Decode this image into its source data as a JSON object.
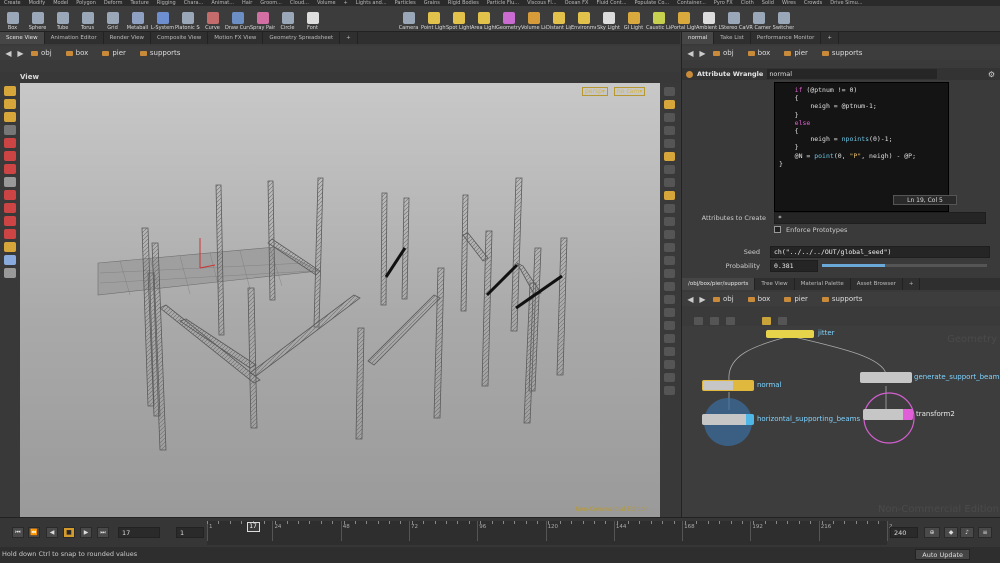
{
  "menubar": [
    "Create",
    "Modify",
    "Model",
    "Polygon",
    "Deform",
    "Texture",
    "Rigging",
    "Chara...",
    "Animat...",
    "Hair",
    "Groom...",
    "Cloud...",
    "Volume",
    "+",
    "Lights and...",
    "Particles",
    "Grains",
    "Rigid Bodies",
    "Particle Flu...",
    "Viscous Fl...",
    "Ocean FX",
    "Fluid Cont...",
    "Populate Co...",
    "Container...",
    "Pyro FX",
    "Cloth",
    "Solid",
    "Wires",
    "Crowds",
    "Drive Simu..."
  ],
  "shelf_left": [
    {
      "label": "Box",
      "color": "#9aa7b8"
    },
    {
      "label": "Sphere",
      "color": "#9aa7b8"
    },
    {
      "label": "Tube",
      "color": "#9aa7b8"
    },
    {
      "label": "Torus",
      "color": "#9aa7b8"
    },
    {
      "label": "Grid",
      "color": "#9aa7b8"
    },
    {
      "label": "Metaball",
      "color": "#8fa1c2"
    },
    {
      "label": "L-System",
      "color": "#6d8fd2"
    },
    {
      "label": "Platonic Sol...",
      "color": "#9aa7b8"
    },
    {
      "label": "Curve",
      "color": "#c46b6b"
    },
    {
      "label": "Draw Curve",
      "color": "#6b8fc4"
    },
    {
      "label": "Spray Paint",
      "color": "#d46fa3"
    },
    {
      "label": "Circle",
      "color": "#9aa7b8"
    },
    {
      "label": "Font",
      "color": "#dddddd"
    }
  ],
  "shelf_right": [
    {
      "label": "Camera",
      "color": "#9aa7b8"
    },
    {
      "label": "Point Light",
      "color": "#e2c24b"
    },
    {
      "label": "Spot Light",
      "color": "#e2c24b"
    },
    {
      "label": "Area Light",
      "color": "#e2c24b"
    },
    {
      "label": "Geometry L...",
      "color": "#c96bd0"
    },
    {
      "label": "Volume Light",
      "color": "#d89b3a"
    },
    {
      "label": "Distant Light",
      "color": "#e2c24b"
    },
    {
      "label": "Environmen...",
      "color": "#e2c24b"
    },
    {
      "label": "Sky Light",
      "color": "#dcdcdc"
    },
    {
      "label": "GI Light",
      "color": "#d9a93d"
    },
    {
      "label": "Caustic Light",
      "color": "#c8d04f"
    },
    {
      "label": "Portal Light",
      "color": "#d9a93d"
    },
    {
      "label": "Ambient Lig...",
      "color": "#dcdcdc"
    },
    {
      "label": "Stereo Cam...",
      "color": "#9aa7b8"
    },
    {
      "label": "VR Camera",
      "color": "#9aa7b8"
    },
    {
      "label": "Switcher",
      "color": "#9aa7b8"
    }
  ],
  "left_tabs": [
    "Scene View",
    "Animation Editor",
    "Render View",
    "Composite View",
    "Motion FX View",
    "Geometry Spreadsheet",
    "+"
  ],
  "path": {
    "root": "obj",
    "items": [
      "box",
      "pier",
      "supports"
    ]
  },
  "view": {
    "title": "View",
    "persp": "persp▾",
    "cam": "no cam▾",
    "watermark": "Non-Commercial Edition"
  },
  "right_top": {
    "tabs": [
      "normal",
      "Take List",
      "Performance Monitor",
      "+"
    ],
    "wrangle_title": "Attribute Wrangle",
    "wrangle_name": "normal",
    "code_lines": [
      {
        "indent": "    ",
        "parts": [
          [
            "kw",
            "if"
          ],
          [
            "",
            " (@ptnum != 0)"
          ]
        ]
      },
      {
        "indent": "    ",
        "parts": [
          [
            "",
            "{"
          ]
        ]
      },
      {
        "indent": "        ",
        "parts": [
          [
            "",
            "neigh = @ptnum-1;"
          ]
        ]
      },
      {
        "indent": "    ",
        "parts": [
          [
            "",
            "}"
          ]
        ]
      },
      {
        "indent": "    ",
        "parts": [
          [
            "kw",
            "else"
          ]
        ]
      },
      {
        "indent": "    ",
        "parts": [
          [
            "",
            "{"
          ]
        ]
      },
      {
        "indent": "        ",
        "parts": [
          [
            "",
            "neigh = "
          ],
          [
            "fn",
            "npoints"
          ],
          [
            "",
            "(0)-1;"
          ]
        ]
      },
      {
        "indent": "    ",
        "parts": [
          [
            "",
            "}"
          ]
        ]
      },
      {
        "indent": "",
        "parts": [
          [
            "",
            ""
          ]
        ]
      },
      {
        "indent": "    ",
        "parts": [
          [
            "",
            "@N = "
          ],
          [
            "fn",
            "point"
          ],
          [
            "",
            "(0, "
          ],
          [
            "st",
            "\"P\""
          ],
          [
            "",
            ", neigh) - @P;"
          ]
        ]
      },
      {
        "indent": "",
        "parts": [
          [
            "",
            "}"
          ]
        ]
      }
    ],
    "cursor": "Ln 19, Col 5",
    "attrs_label": "Attributes to Create",
    "attrs_value": "*",
    "enforce_label": "Enforce Prototypes",
    "seed_label": "Seed",
    "seed_value": "ch(\"../../../OUT/global_seed\")",
    "prob_label": "Probability",
    "prob_value": "0.381",
    "prob_fraction": 0.38
  },
  "right_bottom": {
    "tabs": [
      "/obj/box/pier/supports",
      "Tree View",
      "Material Palette",
      "Asset Browser",
      "+"
    ],
    "path": {
      "root": "obj",
      "items": [
        "box",
        "pier",
        "supports"
      ]
    },
    "watermark_top": "Geometry",
    "watermark_bottom": "Non-Commercial Edition",
    "nodes": {
      "jitter": "jitter",
      "normal": "normal",
      "horizontal": "horizontal_supporting_beams",
      "generate": "generate_support_beams",
      "transform": "transform2"
    }
  },
  "timeline": {
    "current_frame": "17",
    "start": "1",
    "end": "240",
    "labels": [
      "1",
      "24",
      "48",
      "72",
      "96",
      "120",
      "144",
      "168",
      "192",
      "216",
      "2"
    ],
    "playhead": "17",
    "frame_range": [
      1,
      240
    ]
  },
  "status": {
    "message": "Hold down Ctrl to snap to rounded values",
    "auto_update": "Auto Update"
  }
}
